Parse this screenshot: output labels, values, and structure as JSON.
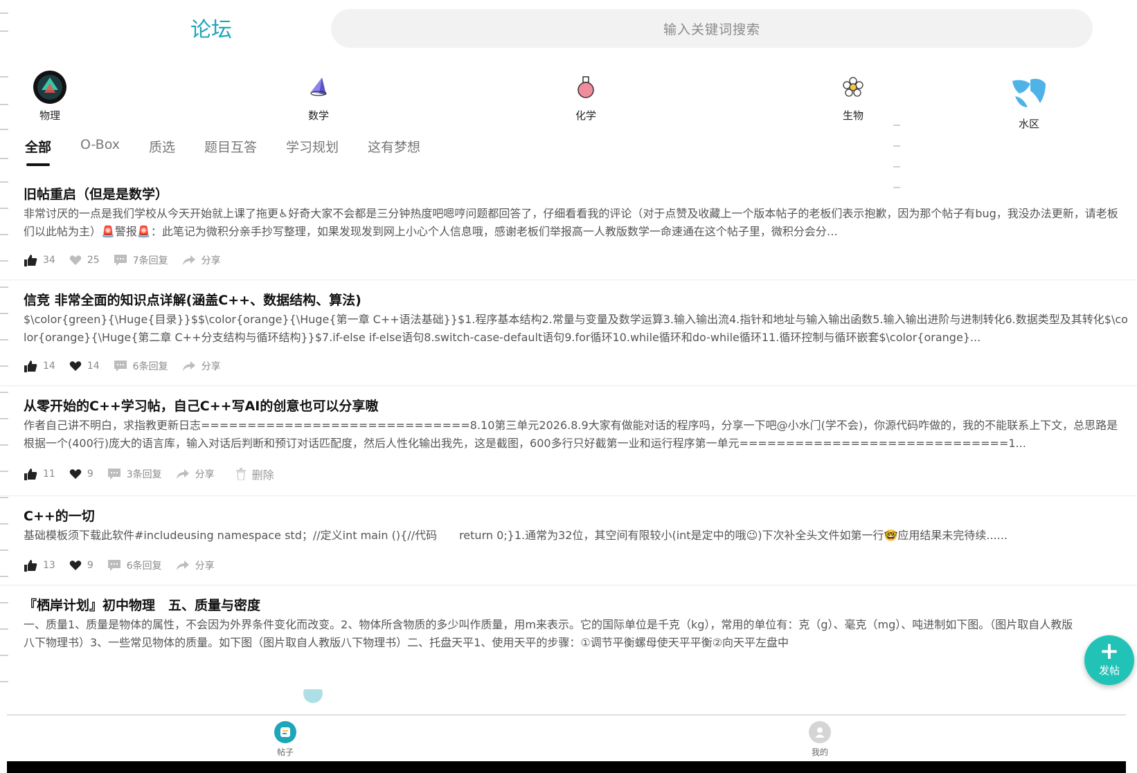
{
  "header": {
    "title": "论坛",
    "search_placeholder": "输入关键词搜索"
  },
  "categories": [
    {
      "label": "物理",
      "icon": "physics-icon"
    },
    {
      "label": "数学",
      "icon": "math-cone-icon"
    },
    {
      "label": "化学",
      "icon": "flask-icon"
    },
    {
      "label": "生物",
      "icon": "flower-icon"
    },
    {
      "label": "水区",
      "icon": "water-icon"
    }
  ],
  "tabs": [
    {
      "label": "全部",
      "active": true
    },
    {
      "label": "O-Box",
      "active": false
    },
    {
      "label": "质选",
      "active": false
    },
    {
      "label": "题目互答",
      "active": false
    },
    {
      "label": "学习规划",
      "active": false
    },
    {
      "label": "这有梦想",
      "active": false
    }
  ],
  "posts": [
    {
      "title": "旧帖重启（但是是数学）",
      "body": "非常讨厌的一点是我们学校从今天开始就上课了拖更♿好奇大家不会都是三分钟热度吧嗯哼问题都回答了，仔细看看我的评论（对于点赞及收藏上一个版本帖子的老板们表示抱歉，因为那个帖子有bug，我没办法更新，请老板们以此帖为主）🚨警报🚨：此笔记为微积分亲手抄写整理，如果发现发到网上小心个人信息哦，感谢老板们举报高一人教版数学一命速通在这个帖子里，微积分会分…",
      "likes": "34",
      "favs": "25",
      "replies": "7条回复",
      "share": "分享",
      "delete": ""
    },
    {
      "title": "信竞 非常全面的知识点详解(涵盖C++、数据结构、算法)",
      "body": "$\\color{green}{\\Huge{目录}}$$\\color{orange}{\\Huge{第一章 C++语法基础}}$1.程序基本结构2.常量与变量及数学运算3.输入输出流4.指针和地址与输入输出函数5.输入输出进阶与进制转化6.数据类型及其转化$\\color{orange}{\\Huge{第二章 C++分支结构与循环结构}}$7.if-else if-else语句8.switch-case-default语句9.for循环10.while循环和do-while循环11.循环控制与循环嵌套$\\color{orange}...",
      "likes": "14",
      "favs": "14",
      "replies": "6条回复",
      "share": "分享",
      "delete": ""
    },
    {
      "title": "从零开始的C++学习帖，自己C++写AI的创意也可以分享嗷",
      "body": "作者自己讲不明白，求指教更新日志=============================8.10第三单元2026.8.9大家有做能对话的程序吗，分享一下吧@小水门(学不会)，你源代码咋做的，我的不能联系上下文，总思路是根据一个(400行)庞大的语言库，输入对话后判断和预订对话匹配度，然后人性化输出我先，这是截图，600多行只好截第一业和运行程序第一单元=============================1...",
      "likes": "11",
      "favs": "9",
      "replies": "3条回复",
      "share": "分享",
      "delete": "删除"
    },
    {
      "title": "C++的一切",
      "body": "基础模板须下载此软件#includeusing namespace std；//定义int main (){//代码　　return 0;}1.通常为32位，其空间有限较小(int是定中的哦😉)下次补全头文件如第一行🤓应用结果未完待续......",
      "likes": "13",
      "favs": "9",
      "replies": "6条回复",
      "share": "分享",
      "delete": ""
    },
    {
      "title": "『栖岸计划』初中物理　五、质量与密度",
      "body": "一、质量1、质量是物体的属性，不会因为外界条件变化而改变。2、物体所含物质的多少叫作质量，用m来表示。它的国际单位是千克（kg），常用的单位有：克（g）、毫克（mg）、吨进制如下图。（图片取自人教版八下物理书）3、一些常见物体的质量。如下图（图片取自人教版八下物理书）二、托盘天平1、使用天平的步骤：①调节平衡螺母使天平平衡②向天平左盘中",
      "likes": "",
      "favs": "",
      "replies": "",
      "share": "",
      "delete": ""
    }
  ],
  "fab": {
    "plus": "+",
    "label": "发帖"
  },
  "bottom_nav": [
    {
      "label": "帖子",
      "icon": "posts-icon"
    },
    {
      "label": "我的",
      "icon": "profile-icon"
    }
  ],
  "colors": {
    "accent": "#1ea5b9",
    "fab": "#22c3b7"
  }
}
